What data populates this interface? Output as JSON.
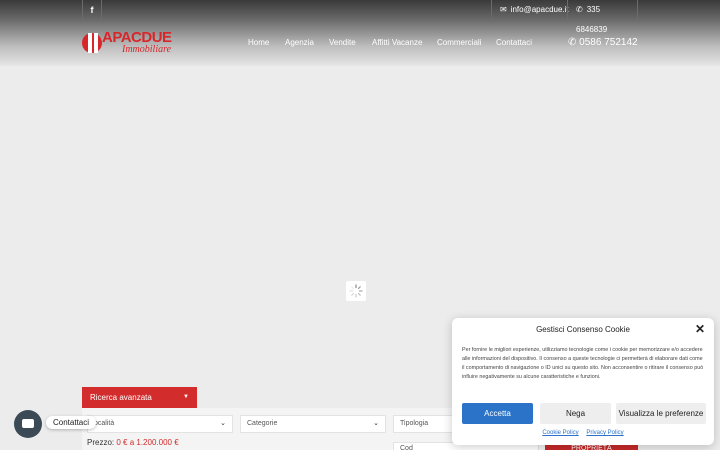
{
  "topbar": {
    "facebook_icon": "f",
    "email": "info@apacdue.it",
    "phone": "335 6846839"
  },
  "logo": {
    "line1": "APACDUE",
    "line2": "Immobiliare",
    "color": "#d8262b"
  },
  "nav": {
    "items": [
      "Home",
      "Agenzia",
      "Vendite",
      "Affitti Vacanze",
      "Commerciali",
      "Contattaci"
    ]
  },
  "header_phone": "0586 752142",
  "search": {
    "advanced_label": "Ricerca avanzata",
    "location_value": "ocalità",
    "category_value": "Categorie",
    "type_value": "Tipologia",
    "price_label": "Prezzo:",
    "price_range": "0 € a 1.200.000 €",
    "code_value": "Cod",
    "search_button": "PROPRIETÀ"
  },
  "contact_widget": {
    "label": "Contattaci"
  },
  "cookie": {
    "title": "Gestisci Consenso Cookie",
    "text": "Per fornire le migliori esperienze, utilizziamo tecnologie come i cookie per memorizzare e/o accedere alle informazioni del dispositivo. Il consenso a queste tecnologie ci permetterà di elaborare dati come il comportamento di navigazione o ID unici su questo sito. Non acconsentire o ritirare il consenso può influire negativamente su alcune caratteristiche e funzioni.",
    "accept": "Accetta",
    "deny": "Nega",
    "preferences": "Visualizza le preferenze",
    "link_cookie_policy": "Cookie Policy",
    "link_privacy_policy": "Privacy Policy"
  },
  "colors": {
    "accent_red": "#d32c2c",
    "accept_blue": "#2a73c9"
  }
}
